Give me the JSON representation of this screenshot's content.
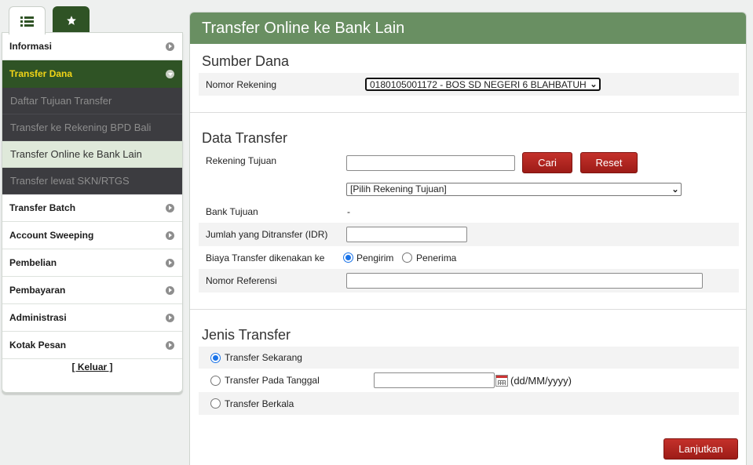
{
  "sidebar": {
    "menu": [
      {
        "label": "Informasi"
      },
      {
        "label": "Transfer Dana",
        "expanded": true,
        "items": [
          {
            "label": "Daftar Tujuan Transfer"
          },
          {
            "label": "Transfer ke Rekening BPD Bali"
          },
          {
            "label": "Transfer Online ke Bank Lain",
            "current": true
          },
          {
            "label": "Transfer lewat SKN/RTGS"
          }
        ]
      },
      {
        "label": "Transfer Batch"
      },
      {
        "label": "Account Sweeping"
      },
      {
        "label": "Pembelian"
      },
      {
        "label": "Pembayaran"
      },
      {
        "label": "Administrasi"
      },
      {
        "label": "Kotak Pesan"
      }
    ],
    "logout": "[ Keluar ]"
  },
  "tabs": {
    "list_icon": "list-icon",
    "favorite_icon": "star-icon"
  },
  "page": {
    "title": "Transfer Online ke Bank Lain"
  },
  "sumber_dana": {
    "title": "Sumber Dana",
    "nomor_rekening_label": "Nomor Rekening",
    "nomor_rekening_value": "0180105001172 - BOS SD NEGERI 6 BLAHBATUH"
  },
  "data_transfer": {
    "title": "Data Transfer",
    "rekening_tujuan_label": "Rekening Tujuan",
    "rekening_tujuan_value": "",
    "cari_button": "Cari",
    "reset_button": "Reset",
    "pilih_rekening_value": "[Pilih Rekening Tujuan]",
    "bank_tujuan_label": "Bank Tujuan",
    "bank_tujuan_value": "-",
    "jumlah_label": "Jumlah yang Ditransfer (IDR)",
    "jumlah_value": "",
    "biaya_label": "Biaya Transfer dikenakan ke",
    "biaya_options": [
      "Pengirim",
      "Penerima"
    ],
    "biaya_selected": "Pengirim",
    "nomor_referensi_label": "Nomor Referensi",
    "nomor_referensi_value": ""
  },
  "jenis_transfer": {
    "title": "Jenis Transfer",
    "options": [
      "Transfer Sekarang",
      "Transfer Pada Tanggal",
      "Transfer Berkala"
    ],
    "selected": "Transfer Sekarang",
    "date_value": "",
    "date_format": "(dd/MM/yyyy)"
  },
  "submit_button": "Lanjutkan",
  "colors": {
    "header": "#698f62",
    "active_menu": "#2f5325",
    "active_menu_text": "#f1d417",
    "button": "#b3241f"
  }
}
